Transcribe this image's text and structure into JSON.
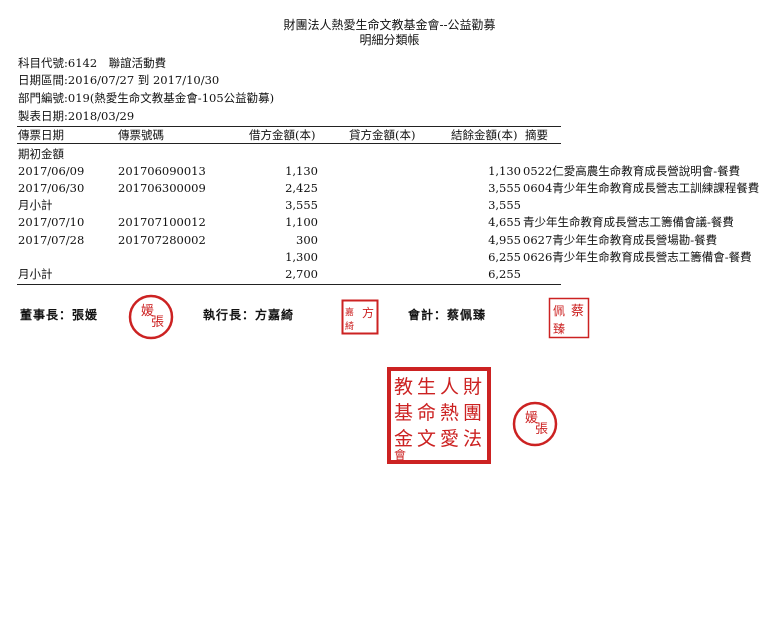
{
  "header": {
    "org_title": "財團法人熱愛生命文教基金會--公益勸募",
    "report_title": "明細分類帳"
  },
  "meta": {
    "account_code": "科目代號:6142　聯誼活動費",
    "date_range": "日期區間:2016/07/27 到 2017/10/30",
    "department": "部門編號:019(熱愛生命文教基金會-105公益勸募)",
    "report_date": "製表日期:2018/03/29"
  },
  "columns": {
    "date": "傳票日期",
    "voucher": "傳票號碼",
    "debit": "借方金額(本)",
    "credit": "貸方金額(本)",
    "balance": "結餘金額(本)",
    "memo": "摘要"
  },
  "rows": [
    {
      "date": "期初金額",
      "voucher": "",
      "debit": "",
      "credit": "",
      "balance": "",
      "memo": ""
    },
    {
      "date": "2017/06/09",
      "voucher": "201706090013",
      "debit": "1,130",
      "credit": "",
      "balance": "1,130",
      "memo": "0522仁愛高農生命教育成長營說明會-餐費"
    },
    {
      "date": "2017/06/30",
      "voucher": "201706300009",
      "debit": "2,425",
      "credit": "",
      "balance": "3,555",
      "memo": "0604青少年生命教育成長營志工訓練課程餐費"
    },
    {
      "date": "月小計",
      "voucher": "",
      "debit": "3,555",
      "credit": "",
      "balance": "3,555",
      "memo": ""
    },
    {
      "date": "2017/07/10",
      "voucher": "201707100012",
      "debit": "1,100",
      "credit": "",
      "balance": "4,655",
      "memo": "青少年生命教育成長營志工籌備會議-餐費"
    },
    {
      "date": "2017/07/28",
      "voucher": "201707280002",
      "debit": "300",
      "credit": "",
      "balance": "4,955",
      "memo": "0627青少年生命教育成長營場勘-餐費"
    },
    {
      "date": "",
      "voucher": "",
      "debit": "1,300",
      "credit": "",
      "balance": "6,255",
      "memo": "0626青少年生命教育成長營志工籌備會-餐費"
    },
    {
      "date": "月小計",
      "voucher": "",
      "debit": "2,700",
      "credit": "",
      "balance": "6,255",
      "memo": ""
    }
  ],
  "signatures": {
    "chairman": "董事長：張媛",
    "executive": "執行長：方嘉綺",
    "accountant": "會計：蔡佩臻"
  },
  "seals": {
    "chairman_seal": "張媛",
    "executive_seal": "方嘉綺",
    "accountant_seal": "蔡佩臻",
    "foundation_seal": "財團法人熱愛生命文教基金會",
    "seal_color": "#cc2222"
  }
}
